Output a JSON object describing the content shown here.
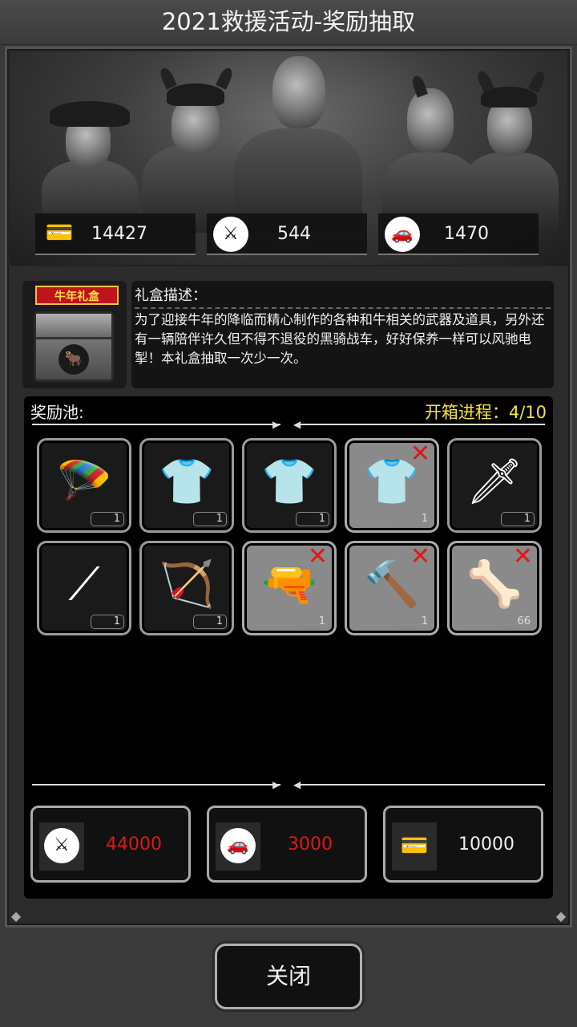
{
  "title": "2021救援活动-奖励抽取",
  "stats": [
    {
      "icon": "ticket-card-icon",
      "value": "14427"
    },
    {
      "icon": "crossed-swords-icon",
      "value": "544"
    },
    {
      "icon": "car-icon",
      "value": "1470"
    }
  ],
  "gift": {
    "label": "牛年礼盒",
    "desc_title": "礼盒描述：",
    "desc_body": "为了迎接牛年的降临而精心制作的各种和牛相关的武器及道具，另外还有一辆陪伴许久但不得不退役的黑骑战车，好好保养一样可以风驰电掣！本礼盒抽取一次少一次。"
  },
  "pool": {
    "title": "奖励池:",
    "progress": "开箱进程：4/10",
    "items": [
      {
        "icon": "parachute-car-icon",
        "glyph": "🪂",
        "qty": "1",
        "claimed": false
      },
      {
        "icon": "outfit-box-icon",
        "glyph": "👕",
        "qty": "1",
        "claimed": false
      },
      {
        "icon": "outfit-box-icon",
        "glyph": "👕",
        "qty": "1",
        "claimed": false
      },
      {
        "icon": "outfit-box-icon",
        "glyph": "👕",
        "qty": "1",
        "claimed": true
      },
      {
        "icon": "horn-knife-icon",
        "glyph": "🗡",
        "qty": "1",
        "claimed": false
      },
      {
        "icon": "staff-icon",
        "glyph": "⟋",
        "qty": "1",
        "claimed": false
      },
      {
        "icon": "crossbow-icon",
        "glyph": "🏹",
        "qty": "1",
        "claimed": false
      },
      {
        "icon": "gauntlet-icon",
        "glyph": "🔫",
        "qty": "1",
        "claimed": true
      },
      {
        "icon": "horn-hammer-icon",
        "glyph": "🔨",
        "qty": "1",
        "claimed": true
      },
      {
        "icon": "bull-horn-icon",
        "glyph": "🦴",
        "qty": "66",
        "claimed": true
      }
    ]
  },
  "costs": [
    {
      "icon": "crossed-swords-icon",
      "value": "44000",
      "color": "#e01818"
    },
    {
      "icon": "car-icon",
      "value": "3000",
      "color": "#e01818"
    },
    {
      "icon": "ticket-card-icon",
      "value": "10000",
      "color": "#f0f0f0"
    }
  ],
  "close_label": "关闭",
  "colors": {
    "progress": "#f5e23a",
    "unaffordable": "#e01818",
    "gift_label_bg": "#c0141c"
  }
}
